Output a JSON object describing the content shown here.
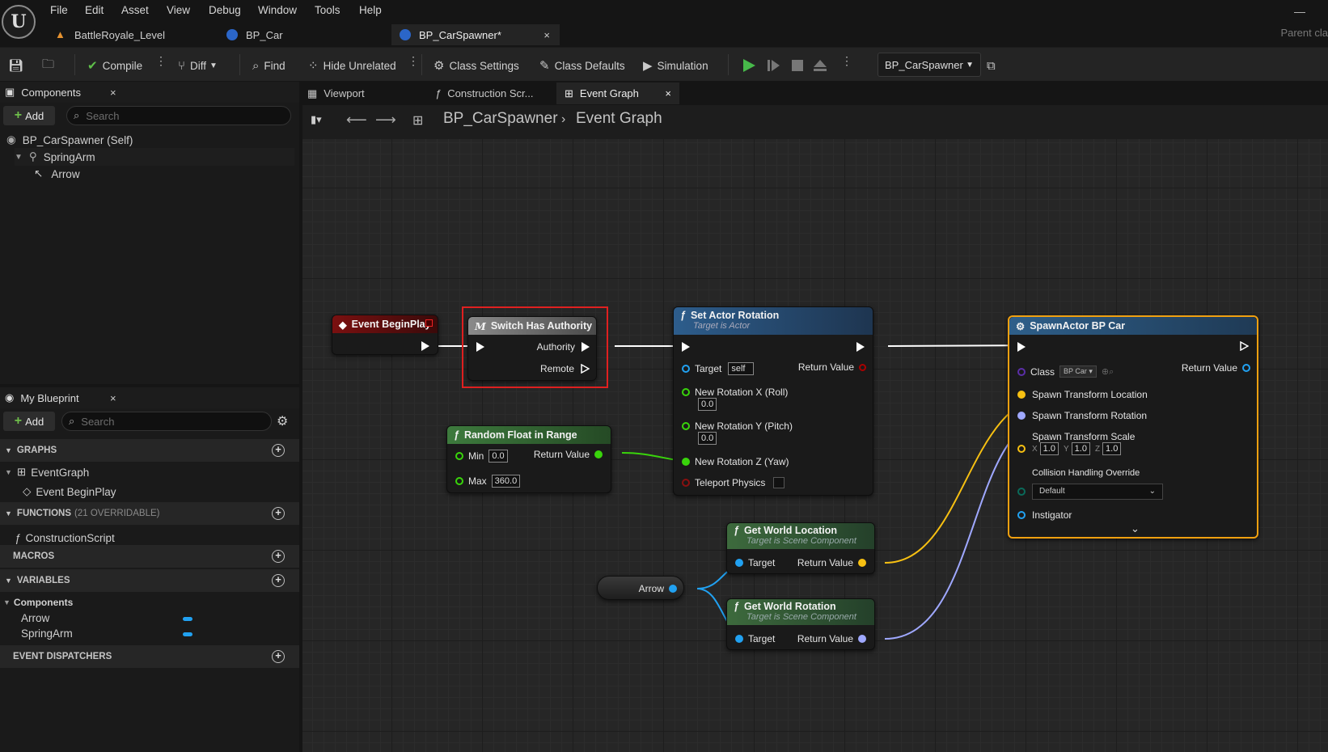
{
  "menu": [
    "File",
    "Edit",
    "Asset",
    "View",
    "Debug",
    "Window",
    "Tools",
    "Help"
  ],
  "doc_tabs": [
    {
      "label": "BattleRoyale_Level"
    },
    {
      "label": "BP_Car"
    },
    {
      "label": "BP_CarSpawner*"
    }
  ],
  "parent_class_label": "Parent cla",
  "toolbar": {
    "compile": "Compile",
    "diff": "Diff",
    "find": "Find",
    "hide_unrelated": "Hide Unrelated",
    "class_settings": "Class Settings",
    "class_defaults": "Class Defaults",
    "simulation": "Simulation",
    "debug_object": "BP_CarSpawner"
  },
  "components_panel": {
    "title": "Components",
    "add": "Add",
    "search_placeholder": "Search",
    "items": [
      "BP_CarSpawner (Self)",
      "SpringArm",
      "Arrow"
    ]
  },
  "my_blueprint": {
    "title": "My Blueprint",
    "add": "Add",
    "search_placeholder": "Search",
    "graphs_label": "GRAPHS",
    "event_graph": "EventGraph",
    "event_begin_play": "Event BeginPlay",
    "functions_label": "FUNCTIONS",
    "functions_count": "(21 OVERRIDABLE)",
    "construction_script": "ConstructionScript",
    "macros_label": "MACROS",
    "variables_label": "VARIABLES",
    "components_label": "Components",
    "variables": [
      "Arrow",
      "SpringArm"
    ],
    "event_dispatchers_label": "EVENT DISPATCHERS"
  },
  "graph_tabs": [
    "Viewport",
    "Construction Scr...",
    "Event Graph"
  ],
  "breadcrumb": {
    "blueprint": "BP_CarSpawner",
    "graph": "Event Graph"
  },
  "nodes": {
    "begin_play": {
      "title": "Event BeginPlay"
    },
    "switch_authority": {
      "title": "Switch Has Authority",
      "authority": "Authority",
      "remote": "Remote"
    },
    "set_rotation": {
      "title": "Set Actor Rotation",
      "subtitle": "Target is Actor",
      "target": "Target",
      "target_val": "self",
      "return": "Return Value",
      "rx": "New Rotation X (Roll)",
      "rx_val": "0.0",
      "ry": "New Rotation Y (Pitch)",
      "ry_val": "0.0",
      "rz": "New Rotation Z (Yaw)",
      "teleport": "Teleport Physics"
    },
    "random_float": {
      "title": "Random Float in Range",
      "min": "Min",
      "min_val": "0.0",
      "max": "Max",
      "max_val": "360.0",
      "return": "Return Value"
    },
    "spawn_actor": {
      "title": "SpawnActor BP Car",
      "class": "Class",
      "class_val": "BP Car",
      "return": "Return Value",
      "loc": "Spawn Transform Location",
      "rot": "Spawn Transform Rotation",
      "scale": "Spawn Transform Scale",
      "sx": "X",
      "sx_val": "1.0",
      "sy": "Y",
      "sy_val": "1.0",
      "sz": "Z",
      "sz_val": "1.0",
      "collision": "Collision Handling Override",
      "collision_val": "Default",
      "instigator": "Instigator"
    },
    "get_world_location": {
      "title": "Get World Location",
      "subtitle": "Target is Scene Component",
      "target": "Target",
      "return": "Return Value"
    },
    "get_world_rotation": {
      "title": "Get World Rotation",
      "subtitle": "Target is Scene Component",
      "target": "Target",
      "return": "Return Value"
    },
    "arrow_var": {
      "label": "Arrow"
    }
  },
  "colors": {
    "exec": "#ffffff",
    "float": "#39d40b",
    "object": "#21a1f1",
    "vector": "#f7c012",
    "rotator": "#9fa8ff",
    "class": "#5b2ea8",
    "selection": "#e02020",
    "spawn_border": "#f0a010"
  }
}
